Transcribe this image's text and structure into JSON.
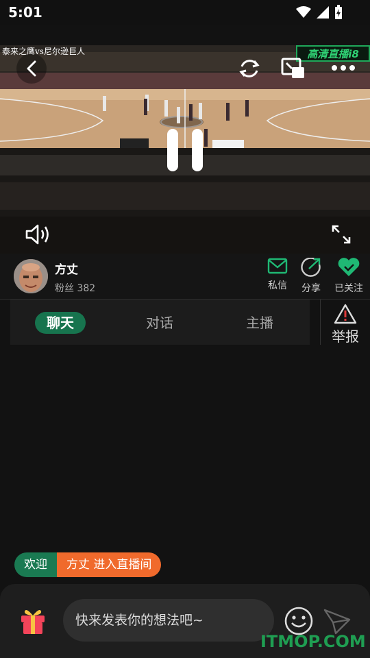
{
  "status": {
    "time": "5:01"
  },
  "video": {
    "title": "泰来之鹰vs尼尔逊巨人",
    "logo_text": "高清直播i8"
  },
  "host": {
    "name": "方丈",
    "fans_label": "粉丝 382"
  },
  "actions": [
    {
      "label": "私信"
    },
    {
      "label": "分享"
    },
    {
      "label": "已关注"
    }
  ],
  "tabs": [
    {
      "label": "聊天",
      "active": true
    },
    {
      "label": "对话",
      "active": false
    },
    {
      "label": "主播",
      "active": false
    }
  ],
  "report": {
    "label": "举报"
  },
  "welcome": {
    "prefix": "欢迎",
    "message": "方丈 进入直播间"
  },
  "composer": {
    "placeholder": "快来发表你的想法吧~"
  },
  "watermark": "ITMOP.COM",
  "colors": {
    "accent": "#17744e",
    "follow": "#1fb874",
    "welcome_orange": "#f06a2c"
  }
}
